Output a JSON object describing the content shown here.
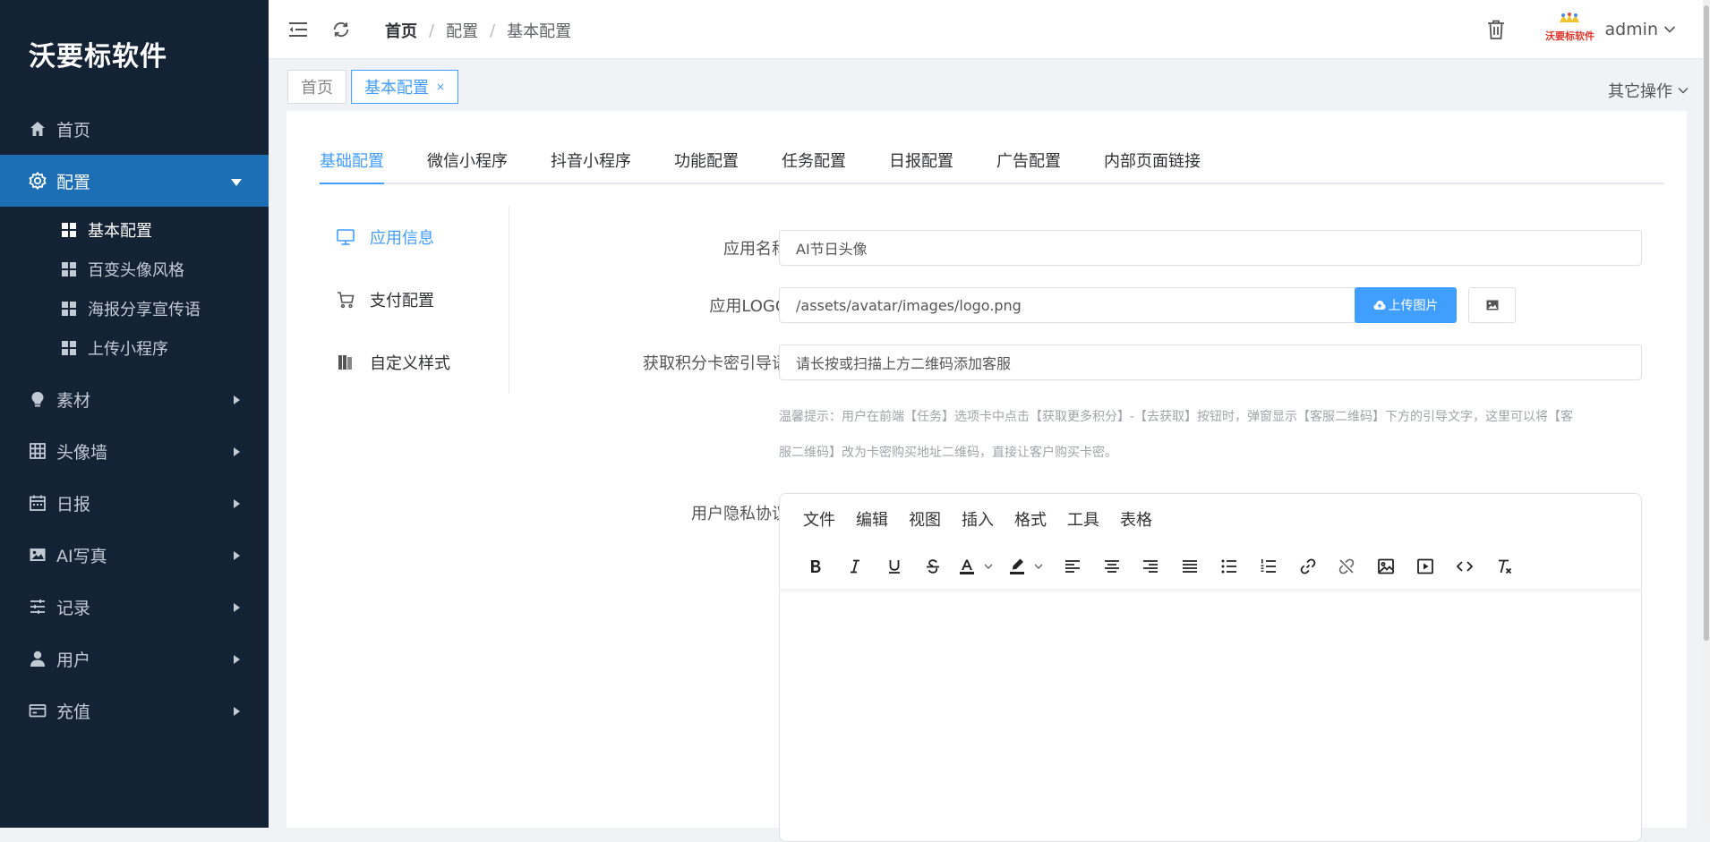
{
  "sidebar": {
    "brand": "沃要标软件",
    "items": [
      {
        "label": "首页",
        "icon": "home-icon"
      },
      {
        "label": "配置",
        "icon": "gear-icon",
        "active": true
      },
      {
        "label": "素材",
        "icon": "bulb-icon"
      },
      {
        "label": "头像墙",
        "icon": "grid-icon"
      },
      {
        "label": "日报",
        "icon": "calendar-icon"
      },
      {
        "label": "AI写真",
        "icon": "image-icon"
      },
      {
        "label": "记录",
        "icon": "sliders-icon"
      },
      {
        "label": "用户",
        "icon": "user-icon"
      },
      {
        "label": "充值",
        "icon": "card-icon"
      }
    ],
    "sub_items": [
      {
        "label": "基本配置",
        "active": true
      },
      {
        "label": "百变头像风格"
      },
      {
        "label": "海报分享宣传语"
      },
      {
        "label": "上传小程序"
      }
    ]
  },
  "header": {
    "breadcrumb": [
      "首页",
      "配置",
      "基本配置"
    ],
    "logo_text": "沃要标软件",
    "username": "admin"
  },
  "tags": {
    "items": [
      "首页",
      "基本配置"
    ],
    "close": "×",
    "other_ops": "其它操作"
  },
  "tabs": [
    "基础配置",
    "微信小程序",
    "抖音小程序",
    "功能配置",
    "任务配置",
    "日报配置",
    "广告配置",
    "内部页面链接"
  ],
  "side_menu": [
    "应用信息",
    "支付配置",
    "自定义样式"
  ],
  "form": {
    "app_name_label": "应用名称",
    "app_name_value": "AI节日头像",
    "app_logo_label": "应用LOGO",
    "app_logo_value": "/assets/avatar/images/logo.png",
    "upload_label": "上传图片",
    "guide_label": "获取积分卡密引导语",
    "guide_value": "请长按或扫描上方二维码添加客服",
    "hint_line1": "温馨提示：用户在前端【任务】选项卡中点击【获取更多积分】-【去获取】按钮时，弹窗显示【客服二维码】下方的引导文字，这里可以将【客",
    "hint_line2": "服二维码】改为卡密购买地址二维码，直接让客户购买卡密。",
    "privacy_label": "用户隐私协议"
  },
  "editor": {
    "menu": [
      "文件",
      "编辑",
      "视图",
      "插入",
      "格式",
      "工具",
      "表格"
    ]
  },
  "colors": {
    "sidebar_bg": "#132235",
    "sidebar_active": "#1c6eb5",
    "primary": "#409eff"
  }
}
